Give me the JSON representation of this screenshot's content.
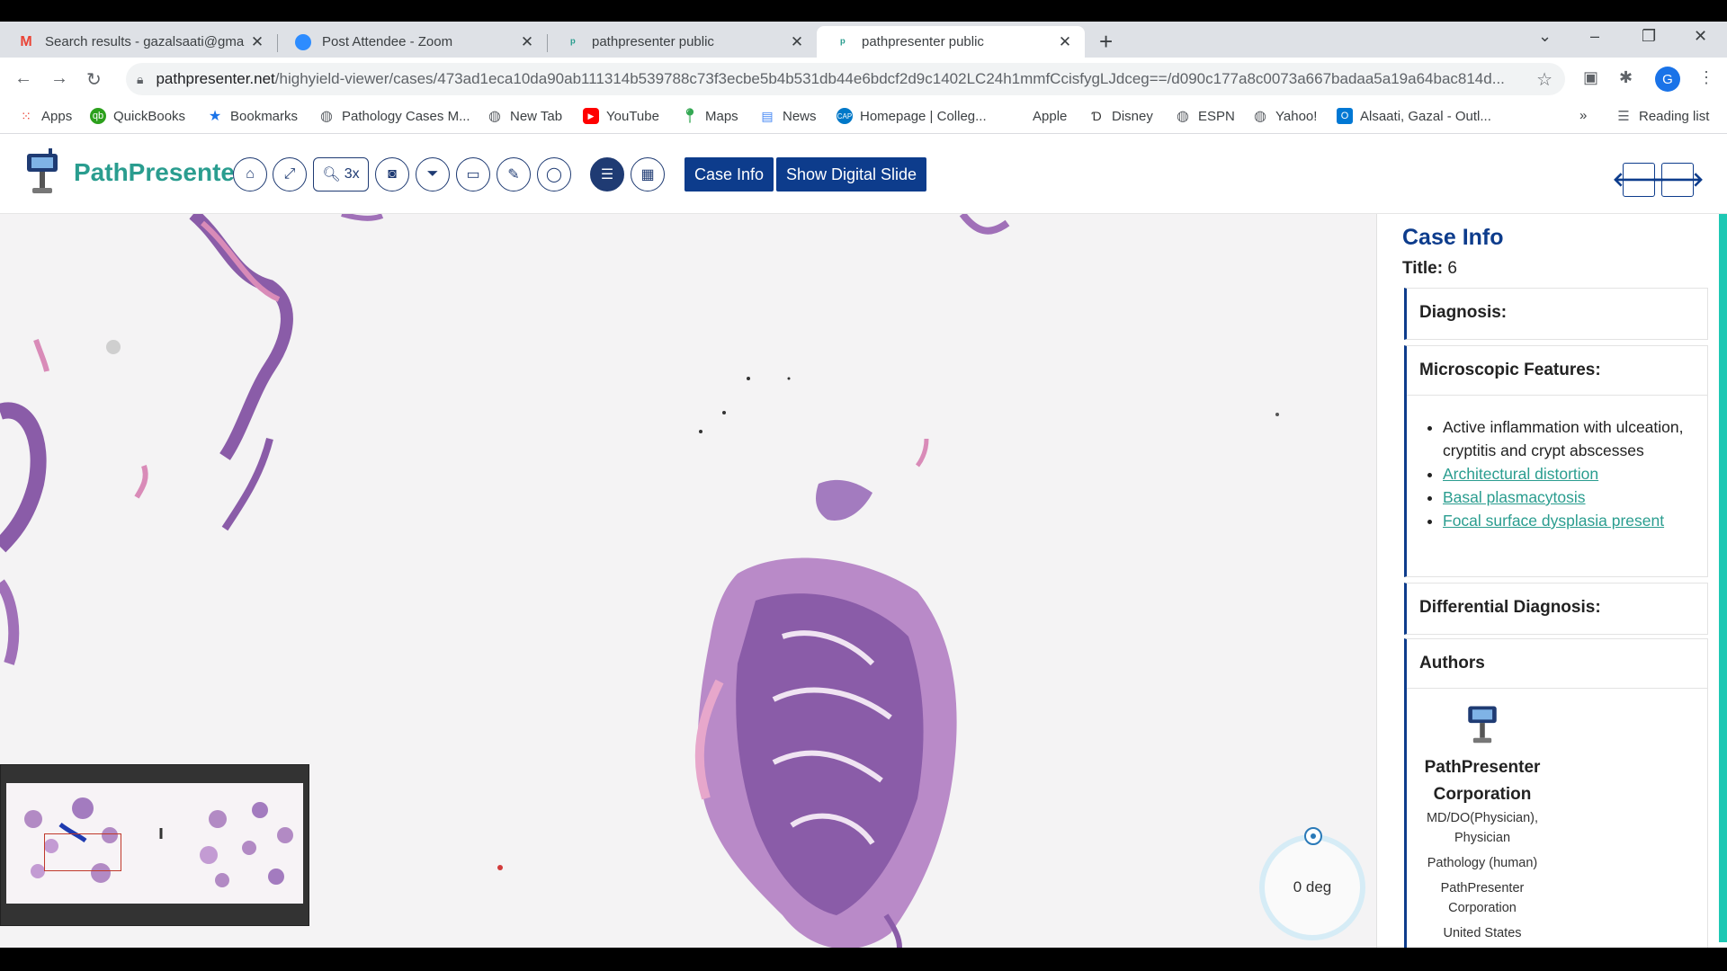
{
  "browser": {
    "tabs": [
      {
        "title": "Search results - gazalsaati@gma",
        "favicon": "gmail-icon",
        "close": "✕"
      },
      {
        "title": "Post Attendee - Zoom",
        "favicon": "zoom-icon",
        "close": "✕"
      },
      {
        "title": "pathpresenter public",
        "favicon": "pathpresenter-icon",
        "close": "✕"
      },
      {
        "title": "pathpresenter public",
        "favicon": "pathpresenter-icon",
        "close": "✕",
        "active": true
      }
    ],
    "url_host": "pathpresenter.net",
    "url_path": "/highyield-viewer/cases/473ad1eca10da90ab111314b539788c73f3ecbe5b4b531db44e6bdcf2d9c1402LC24h1mmfCcisfygLJdceg==/d090c177a8c0073a667badaa5a19a64bac814d...",
    "profile_initial": "G",
    "bookmarks": [
      "Apps",
      "QuickBooks",
      "Bookmarks",
      "Pathology Cases M...",
      "New Tab",
      "YouTube",
      "Maps",
      "News",
      "Homepage | Colleg...",
      "Apple",
      "Disney",
      "ESPN",
      "Yahoo!",
      "Alsaati, Gazal - Outl..."
    ],
    "bookmarks_overflow": "»",
    "reading_list": "Reading list"
  },
  "app": {
    "logo_text": "PathPresenter",
    "zoom_label": "3x",
    "case_info_button": "Case Info",
    "digital_slide_button": "Show Digital Slide",
    "prev_arrow": "🡐",
    "next_arrow": "🡒"
  },
  "viewer": {
    "rotation_label": "0 deg"
  },
  "panel": {
    "title": "Case Info",
    "case_title_label": "Title:",
    "case_title_value": "6",
    "diagnosis_heading": "Diagnosis:",
    "microscopic_heading": "Microscopic Features:",
    "features": [
      {
        "text": "Active inflammation with ulceation, cryptitis and crypt abscesses",
        "link": false
      },
      {
        "text": "Architectural distortion",
        "link": true
      },
      {
        "text": "Basal plasmacytosis",
        "link": true
      },
      {
        "text": "Focal surface dysplasia present",
        "link": true
      }
    ],
    "differential_heading": "Differential Diagnosis:",
    "authors_heading": "Authors",
    "author": {
      "name": "PathPresenter Corporation",
      "degree": "MD/DO(Physician), Physician",
      "specialty": "Pathology (human)",
      "org": "PathPresenter Corporation",
      "country": "United States"
    }
  },
  "colors": {
    "brand_teal": "#2a9d8f",
    "brand_navy": "#0d3c8c",
    "accent_bar": "#1ec8b4",
    "tissue_purple": "#8a5ca8",
    "tissue_pink": "#d98bb8"
  }
}
